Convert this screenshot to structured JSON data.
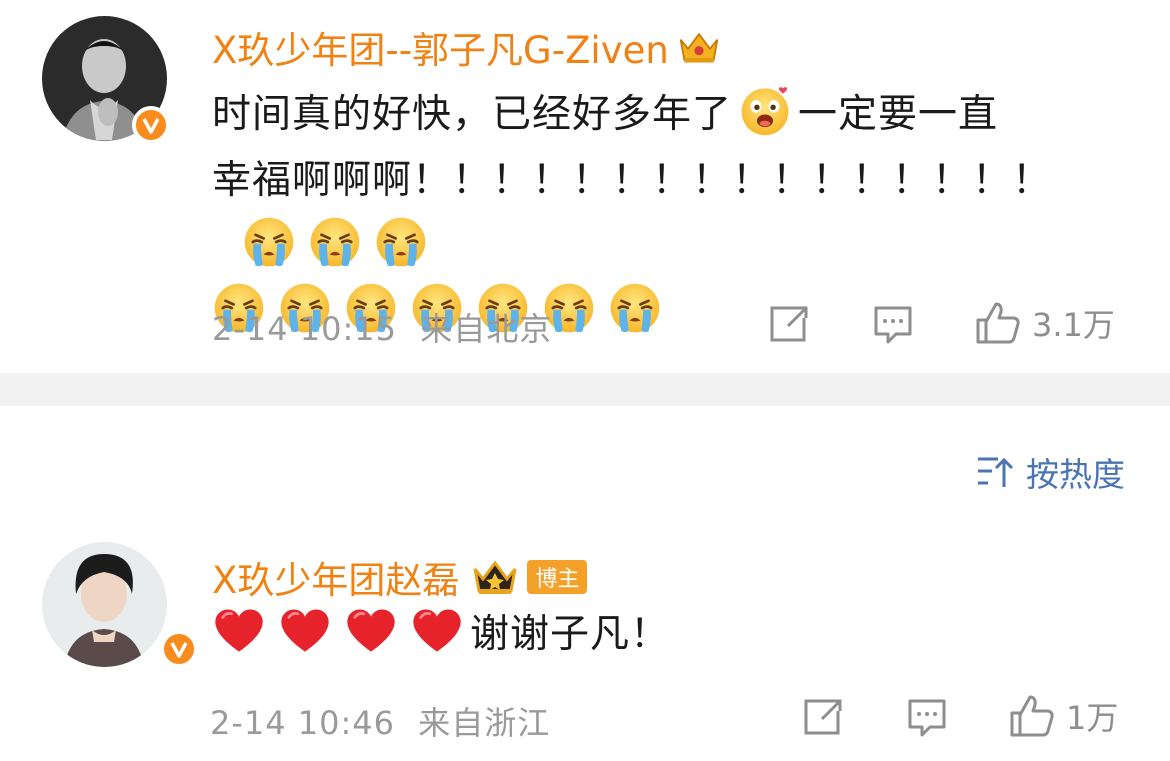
{
  "comments": [
    {
      "username": "X玖少年团--郭子凡G-Ziven",
      "text_line1_a": "时间真的好快，已经好多年了",
      "text_line1_b": "一定要一直",
      "text_line2": "幸福啊啊啊！！！！！！！！！！！！！！！！",
      "emoji_names": [
        "grin-emoji",
        "cry-emoji"
      ],
      "time": "2-14 10:15",
      "location": "来自北京",
      "likes": "3.1万"
    },
    {
      "username": "X玖少年团赵磊",
      "badge": "博主",
      "text_suffix": "谢谢子凡！",
      "emoji_names": [
        "heart-emoji"
      ],
      "time": "2-14 10:46",
      "location": "来自浙江",
      "likes": "1万"
    }
  ],
  "sort_label": "按热度",
  "colors": {
    "username": "#f08214",
    "verified": "#f98c1c",
    "sort": "#4a74b3",
    "meta": "#9a9a9a"
  }
}
